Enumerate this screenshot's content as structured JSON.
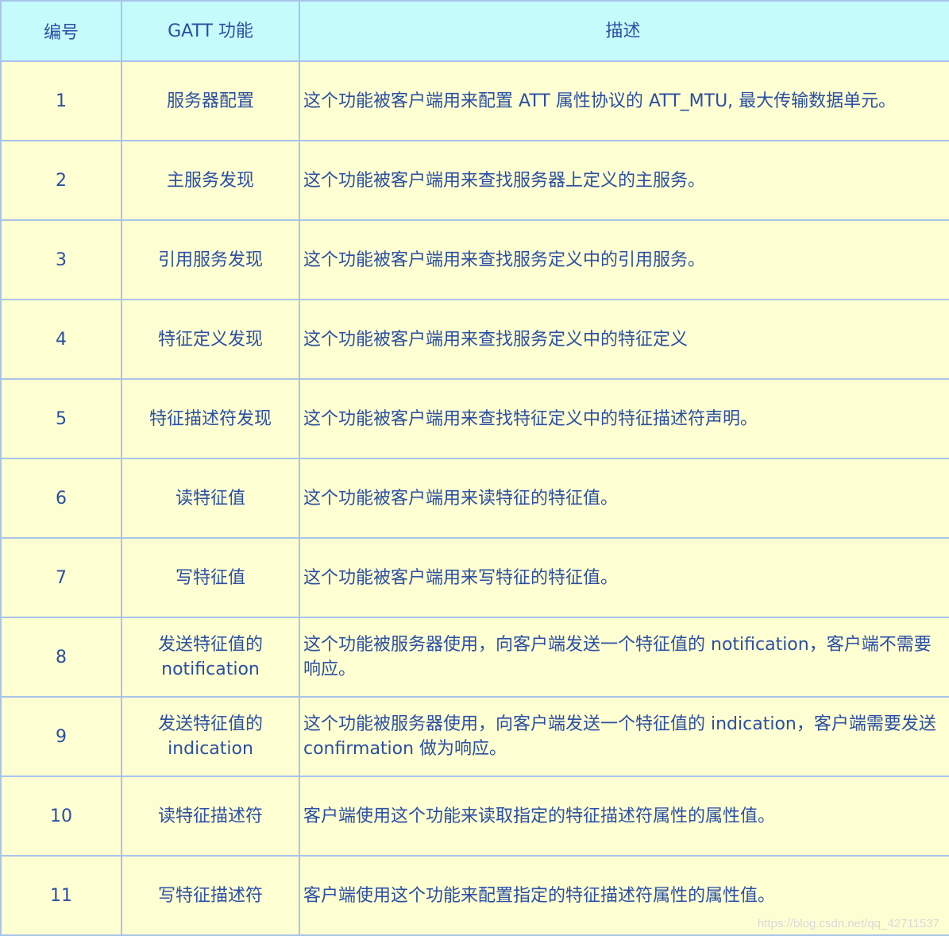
{
  "table": {
    "headers": [
      "编号",
      "GATT 功能",
      "描述"
    ],
    "rows": [
      {
        "num": "1",
        "func": [
          "服务器配置"
        ],
        "desc": "这个功能被客户端用来配置 ATT 属性协议的 ATT_MTU, 最大传输数据单元。"
      },
      {
        "num": "2",
        "func": [
          "主服务发现"
        ],
        "desc": "这个功能被客户端用来查找服务器上定义的主服务。"
      },
      {
        "num": "3",
        "func": [
          "引用服务发现"
        ],
        "desc": "这个功能被客户端用来查找服务定义中的引用服务。"
      },
      {
        "num": "4",
        "func": [
          "特征定义发现"
        ],
        "desc": "这个功能被客户端用来查找服务定义中的特征定义"
      },
      {
        "num": "5",
        "func": [
          "特征描述符发现"
        ],
        "desc": "这个功能被客户端用来查找特征定义中的特征描述符声明。"
      },
      {
        "num": "6",
        "func": [
          "读特征值"
        ],
        "desc": "这个功能被客户端用来读特征的特征值。"
      },
      {
        "num": "7",
        "func": [
          "写特征值"
        ],
        "desc": "这个功能被客户端用来写特征的特征值。"
      },
      {
        "num": "8",
        "func": [
          "发送特征值的",
          "notification"
        ],
        "desc": "这个功能被服务器使用，向客户端发送一个特征值的 notification，客户端不需要响应。"
      },
      {
        "num": "9",
        "func": [
          "发送特征值的",
          "indication"
        ],
        "desc": "这个功能被服务器使用，向客户端发送一个特征值的 indication，客户端需要发送 confirmation 做为响应。"
      },
      {
        "num": "10",
        "func": [
          "读特征描述符"
        ],
        "desc": "客户端使用这个功能来读取指定的特征描述符属性的属性值。"
      },
      {
        "num": "11",
        "func": [
          "写特征描述符"
        ],
        "desc": "客户端使用这个功能来配置指定的特征描述符属性的属性值。"
      }
    ]
  },
  "watermark": "https://blog.csdn.net/qq_42711537"
}
